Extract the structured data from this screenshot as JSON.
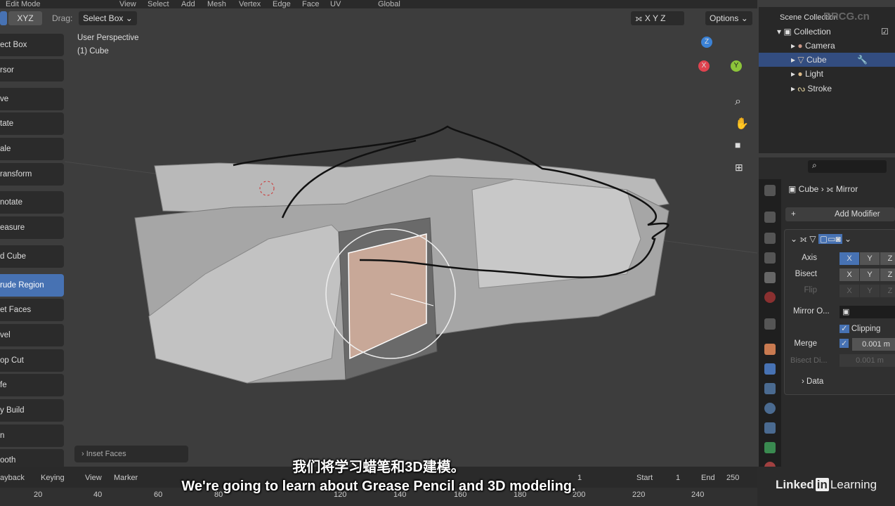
{
  "header": {
    "mode": "Edit Mode",
    "menus": [
      "View",
      "Select",
      "Add",
      "Mesh",
      "Vertex",
      "Edge",
      "Face",
      "UV"
    ],
    "orientation": "Global",
    "axis_toggle": "XYZ",
    "drag_label": "Drag:",
    "drag_value": "Select Box",
    "mirror_axes": [
      "X",
      "Y",
      "Z"
    ],
    "options": "Options"
  },
  "viewport": {
    "perspective": "User Perspective",
    "object": "(1) Cube",
    "last_op": "Inset Faces",
    "gizmo": {
      "x": "X",
      "y": "Y",
      "z": "Z"
    }
  },
  "toolbar": {
    "items": [
      "ect Box",
      "rsor",
      "ve",
      "tate",
      "ale",
      "ransform",
      "notate",
      "easure",
      "d Cube",
      "rude Region",
      "et Faces",
      "vel",
      "op Cut",
      "fe",
      "y Build",
      "n",
      "ooth"
    ],
    "selected": "rude Region"
  },
  "outliner": {
    "root": "Scene Collection",
    "collection": "Collection",
    "items": [
      "Camera",
      "Cube",
      "Light",
      "Stroke"
    ],
    "selected": "Cube"
  },
  "properties": {
    "breadcrumb_object": "Cube",
    "breadcrumb_modifier": "Mirror",
    "add_modifier": "Add Modifier",
    "axis_label": "Axis",
    "bisect_label": "Bisect",
    "flip_label": "Flip",
    "xyz": [
      "X",
      "Y",
      "Z"
    ],
    "axis_active": "X",
    "mirror_object_label": "Mirror O...",
    "clipping_label": "Clipping",
    "clipping": true,
    "merge_label": "Merge",
    "merge": true,
    "merge_value": "0.001 m",
    "bisect_dist_label": "Bisect Di...",
    "bisect_dist_value": "0.001 m",
    "data_label": "Data"
  },
  "timeline": {
    "menus": [
      "ayback",
      "Keying",
      "View",
      "Marker"
    ],
    "current_frame": "1",
    "start_label": "Start",
    "start": "1",
    "end_label": "End",
    "end": "250",
    "ticks": [
      "20",
      "40",
      "60",
      "80",
      "120",
      "140",
      "160",
      "180",
      "200",
      "220",
      "240"
    ]
  },
  "subtitles": {
    "zh": "我们将学习蜡笔和3D建模。",
    "en": "We're going to learn about Grease Pencil and 3D modeling."
  },
  "watermark": "RRCG.cn",
  "brand": {
    "linkedin": "Linked",
    "in": "in",
    "learning": "Learning"
  },
  "colors": {
    "accent": "#4772b3",
    "x": "#e0434f",
    "y": "#8cc43a",
    "z": "#3b82d6"
  }
}
